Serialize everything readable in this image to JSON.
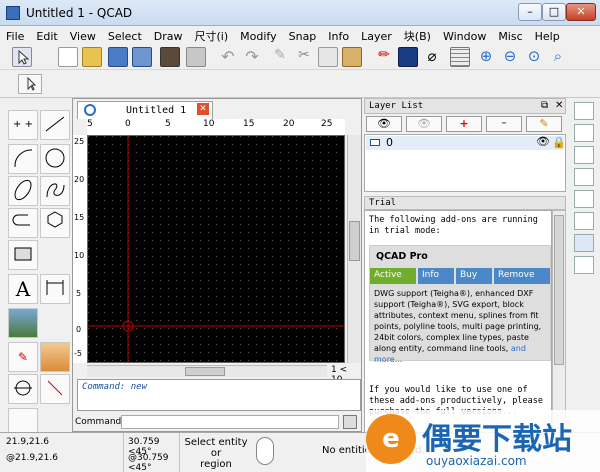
{
  "window": {
    "title": "Untitled 1 - QCAD",
    "minimize": "–",
    "maximize": "□",
    "close": "✕"
  },
  "menu": [
    "File",
    "Edit",
    "View",
    "Select",
    "Draw",
    "尺寸(i)",
    "Modify",
    "Snap",
    "Info",
    "Layer",
    "块(B)",
    "Window",
    "Misc",
    "Help"
  ],
  "document": {
    "tab_title": "Untitled 1",
    "ruler_top": [
      "5",
      "0",
      "5",
      "10",
      "15",
      "20",
      "25"
    ],
    "ruler_left": [
      "25",
      "20",
      "15",
      "10",
      "5",
      "0",
      "-5"
    ],
    "hscroll_label": "1 < 10",
    "command_history": "Command: new",
    "command_label": "Command:"
  },
  "layer_list": {
    "title": "Layer List",
    "layers": [
      {
        "name": "0"
      }
    ]
  },
  "trial": {
    "title": "Trial",
    "intro": "The following add-ons are running in trial mode:",
    "product": "QCAD Pro",
    "tabs": [
      "Active",
      "Info",
      "Buy",
      "Remove"
    ],
    "description": "DWG support (Teigha®), enhanced DXF support (Teigha®), SVG export, block attributes, context menu, splines from fit points, polyline tools, multi page printing, 24bit colors, complex line types, paste along entity, command line tools,",
    "more_link": "and more...",
    "footer": "If you would like to use one of these add-ons productively, please purchase the full versions..."
  },
  "status": {
    "rel": "21.9,21.6",
    "abs": "@21.9,21.6",
    "polar": "30.759 <45°",
    "polar_rel": "@30.759 <45°",
    "hint_line1": "Select entity or",
    "hint_line2": "region",
    "selection": "No entities selected."
  },
  "watermark": {
    "text": "偶要下载站",
    "url": "ouyaoxiazai.com"
  },
  "colors": {
    "accent": "#3a6fc0",
    "trial_tab_active": "#6fae2b",
    "trial_tab": "#4b88c8",
    "crosshair": "#c00000"
  }
}
